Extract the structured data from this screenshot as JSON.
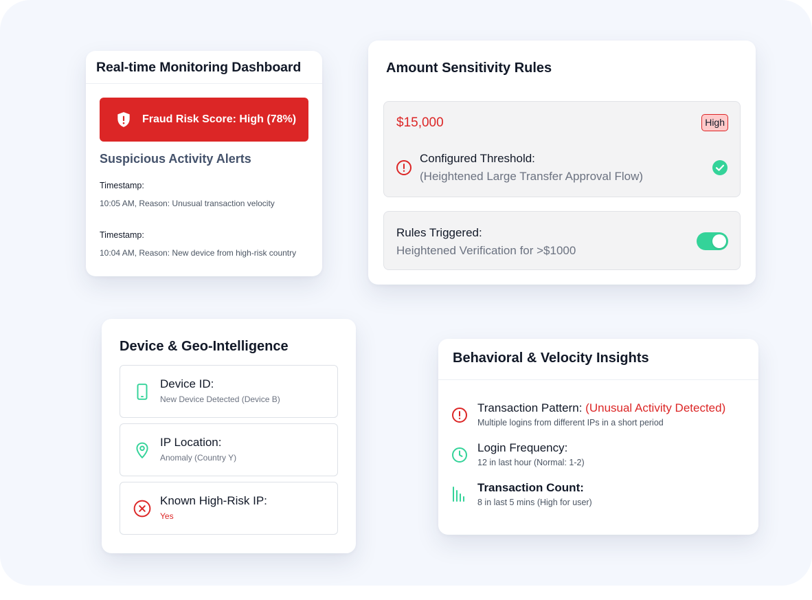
{
  "colors": {
    "danger": "#dc2626",
    "success": "#34d399",
    "background": "#f4f7fd",
    "card": "#ffffff"
  },
  "monitoring": {
    "title": "Real-time Monitoring Dashboard",
    "risk_icon": "shield-alert-icon",
    "risk_text": "Fraud Risk Score: High (78%)",
    "alerts_title": "Suspicious Activity Alerts",
    "alerts": [
      {
        "label": "Timestamp:",
        "detail": "10:05 AM, Reason: Unusual transaction velocity"
      },
      {
        "label": "Timestamp:",
        "detail": "10:04 AM, Reason: New device from high-risk country"
      }
    ]
  },
  "amount": {
    "title": "Amount Sensitivity Rules",
    "value": "$15,000",
    "badge": "High",
    "threshold_icon": "alert-circle-icon",
    "threshold_title": "Configured Threshold:",
    "threshold_sub": "(Heightened Large Transfer Approval Flow)",
    "threshold_status_icon": "check-circle-icon",
    "rules_title": "Rules Triggered:",
    "rules_sub": "Heightened Verification for >$1000",
    "rules_toggle_on": true
  },
  "device": {
    "title": "Device & Geo-Intelligence",
    "items": [
      {
        "icon": "smartphone-icon",
        "title": "Device ID:",
        "sub": "New Device Detected (Device B)"
      },
      {
        "icon": "map-pin-icon",
        "title": "IP Location:",
        "sub": "Anomaly (Country Y)"
      },
      {
        "icon": "x-circle-icon",
        "title": "Known High-Risk IP:",
        "sub": "Yes"
      }
    ]
  },
  "behavioral": {
    "title": "Behavioral & Velocity Insights",
    "items": [
      {
        "icon": "alert-circle-icon",
        "title": "Transaction Pattern: ",
        "highlight": "(Unusual Activity Detected)",
        "sub": "Multiple logins from different IPs in a short period"
      },
      {
        "icon": "clock-icon",
        "title": "Login Frequency:",
        "sub": "12 in last hour (Normal: 1-2)"
      },
      {
        "icon": "bar-chart-icon",
        "title": "Transaction Count:",
        "sub": "8 in last 5 mins (High for user)"
      }
    ]
  }
}
